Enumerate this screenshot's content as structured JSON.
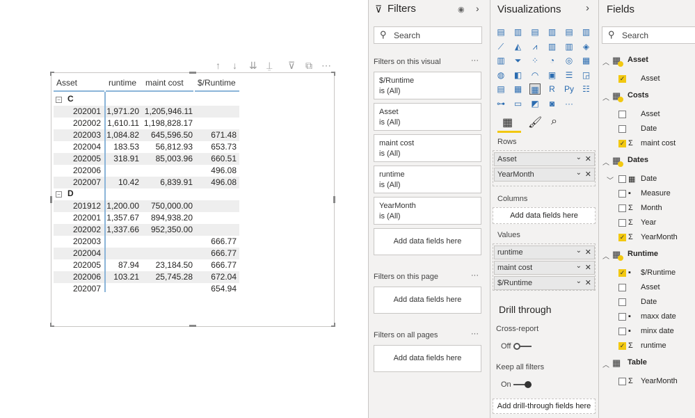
{
  "visual_toolbar": {
    "icons": [
      "arrow-up-icon",
      "arrow-down-icon",
      "double-arrow-down-icon",
      "expand-hierarchy-icon",
      "filter-icon",
      "focus-mode-icon",
      "more-options-icon"
    ]
  },
  "table": {
    "headers": [
      "Asset",
      "runtime",
      "maint cost",
      "$/Runtime"
    ],
    "groups": [
      {
        "name": "C",
        "rows": [
          [
            "202001",
            "1,971.20",
            "1,205,946.11",
            ""
          ],
          [
            "202002",
            "1,610.11",
            "1,198,828.17",
            ""
          ],
          [
            "202003",
            "1,084.82",
            "645,596.50",
            "671.48"
          ],
          [
            "202004",
            "183.53",
            "56,812.93",
            "653.73"
          ],
          [
            "202005",
            "318.91",
            "85,003.96",
            "660.51"
          ],
          [
            "202006",
            "",
            "",
            "496.08"
          ],
          [
            "202007",
            "10.42",
            "6,839.91",
            "496.08"
          ]
        ]
      },
      {
        "name": "D",
        "rows": [
          [
            "201912",
            "1,200.00",
            "750,000.00",
            ""
          ],
          [
            "202001",
            "1,357.67",
            "894,938.20",
            ""
          ],
          [
            "202002",
            "1,337.66",
            "952,350.00",
            ""
          ],
          [
            "202003",
            "",
            "",
            "666.77"
          ],
          [
            "202004",
            "",
            "",
            "666.77"
          ],
          [
            "202005",
            "87.94",
            "23,184.50",
            "666.77"
          ],
          [
            "202006",
            "103.21",
            "25,745.28",
            "672.04"
          ],
          [
            "202007",
            "",
            "",
            "654.94"
          ]
        ]
      }
    ]
  },
  "filters": {
    "title": "Filters",
    "search_placeholder": "Search",
    "on_visual_label": "Filters on this visual",
    "cards": [
      {
        "name": "$/Runtime",
        "value": "is (All)"
      },
      {
        "name": "Asset",
        "value": "is (All)"
      },
      {
        "name": "maint cost",
        "value": "is (All)"
      },
      {
        "name": "runtime",
        "value": "is (All)"
      },
      {
        "name": "YearMonth",
        "value": "is (All)"
      }
    ],
    "add_label": "Add data fields here",
    "on_page_label": "Filters on this page",
    "all_pages_label": "Filters on all pages",
    "more": "···"
  },
  "visualizations": {
    "title": "Visualizations",
    "rows_label": "Rows",
    "rows": [
      "Asset",
      "YearMonth"
    ],
    "columns_label": "Columns",
    "columns_add": "Add data fields here",
    "values_label": "Values",
    "values": [
      "runtime",
      "maint cost",
      "$/Runtime"
    ],
    "drill_title": "Drill through",
    "cross_report_label": "Cross-report",
    "cross_report_state": "Off",
    "keep_filters_label": "Keep all filters",
    "keep_filters_state": "On",
    "drill_add": "Add drill-through fields here",
    "icon_glyphs": [
      "▤",
      "▥",
      "▤",
      "▥",
      "▤",
      "▥",
      "⟋",
      "◭",
      "⩘",
      "▥",
      "▥",
      "◈",
      "▥",
      "⏷",
      "⁘",
      "◔",
      "◎",
      "▦",
      "◍",
      "◧",
      "◠",
      "▣",
      "☰",
      "◲",
      "▤",
      "▦",
      "▦",
      "R",
      "Py",
      "☷",
      "⊶",
      "▭",
      "◩",
      "◙",
      "···",
      ""
    ],
    "accent": "#f2c811"
  },
  "fields": {
    "title": "Fields",
    "search_placeholder": "Search",
    "tables": [
      {
        "name": "Asset",
        "items": [
          {
            "label": "Asset",
            "checked": true,
            "icon": ""
          }
        ]
      },
      {
        "name": "Costs",
        "items": [
          {
            "label": "Asset",
            "checked": false,
            "icon": ""
          },
          {
            "label": "Date",
            "checked": false,
            "icon": ""
          },
          {
            "label": "maint cost",
            "checked": true,
            "icon": "Σ"
          }
        ]
      },
      {
        "name": "Dates",
        "items": [
          {
            "label": "Date",
            "checked": false,
            "icon": "▦"
          },
          {
            "label": "Measure",
            "checked": false,
            "icon": "▪"
          },
          {
            "label": "Month",
            "checked": false,
            "icon": "Σ"
          },
          {
            "label": "Year",
            "checked": false,
            "icon": "Σ"
          },
          {
            "label": "YearMonth",
            "checked": true,
            "icon": "Σ"
          }
        ]
      },
      {
        "name": "Runtime",
        "items": [
          {
            "label": "$/Runtime",
            "checked": true,
            "icon": "▪"
          },
          {
            "label": "Asset",
            "checked": false,
            "icon": ""
          },
          {
            "label": "Date",
            "checked": false,
            "icon": ""
          },
          {
            "label": "maxx date",
            "checked": false,
            "icon": "▪"
          },
          {
            "label": "minx date",
            "checked": false,
            "icon": "▪"
          },
          {
            "label": "runtime",
            "checked": true,
            "icon": "Σ"
          }
        ]
      },
      {
        "name": "Table",
        "items": [
          {
            "label": "YearMonth",
            "checked": false,
            "icon": "Σ"
          }
        ]
      }
    ]
  }
}
